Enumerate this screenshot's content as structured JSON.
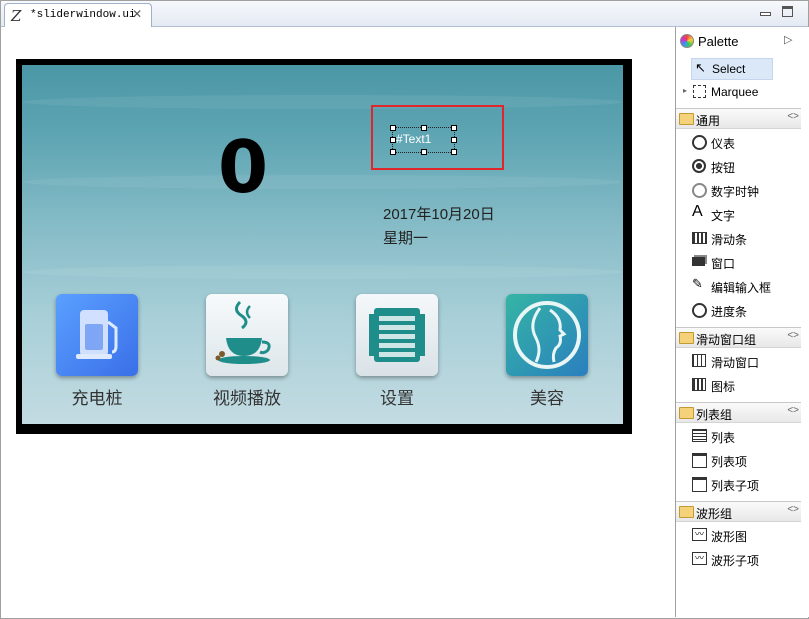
{
  "tab": {
    "title": "*sliderwindow.ui",
    "icon": "Z"
  },
  "screen": {
    "counter": "0",
    "text_widget": "#Text1",
    "date": "2017年10月20日",
    "weekday": "星期一",
    "apps": [
      {
        "label": "充电桩",
        "icon": "charging-pile-icon",
        "color": "#4a8cf0"
      },
      {
        "label": "视频播放",
        "icon": "coffee-cup-icon",
        "color": "#eef3f5"
      },
      {
        "label": "设置",
        "icon": "settings-icon",
        "color": "#e8eef2"
      },
      {
        "label": "美容",
        "icon": "beauty-face-icon",
        "color": "#2aa9a0"
      }
    ]
  },
  "palette": {
    "title": "Palette",
    "tools": [
      {
        "label": "Select"
      },
      {
        "label": "Marquee"
      }
    ],
    "groups": [
      {
        "label": "通用",
        "items": [
          "仪表",
          "按钮",
          "数字时钟",
          "文字",
          "滑动条",
          "窗口",
          "编辑输入框",
          "进度条"
        ]
      },
      {
        "label": "滑动窗口组",
        "items": [
          "滑动窗口",
          "图标"
        ]
      },
      {
        "label": "列表组",
        "items": [
          "列表",
          "列表项",
          "列表子项"
        ]
      },
      {
        "label": "波形组",
        "items": [
          "波形图",
          "波形子项"
        ]
      }
    ]
  },
  "colors": {
    "selection_red": "#e0262b",
    "screen_top": "#4b97a6",
    "screen_bottom": "#c3dbe2"
  }
}
